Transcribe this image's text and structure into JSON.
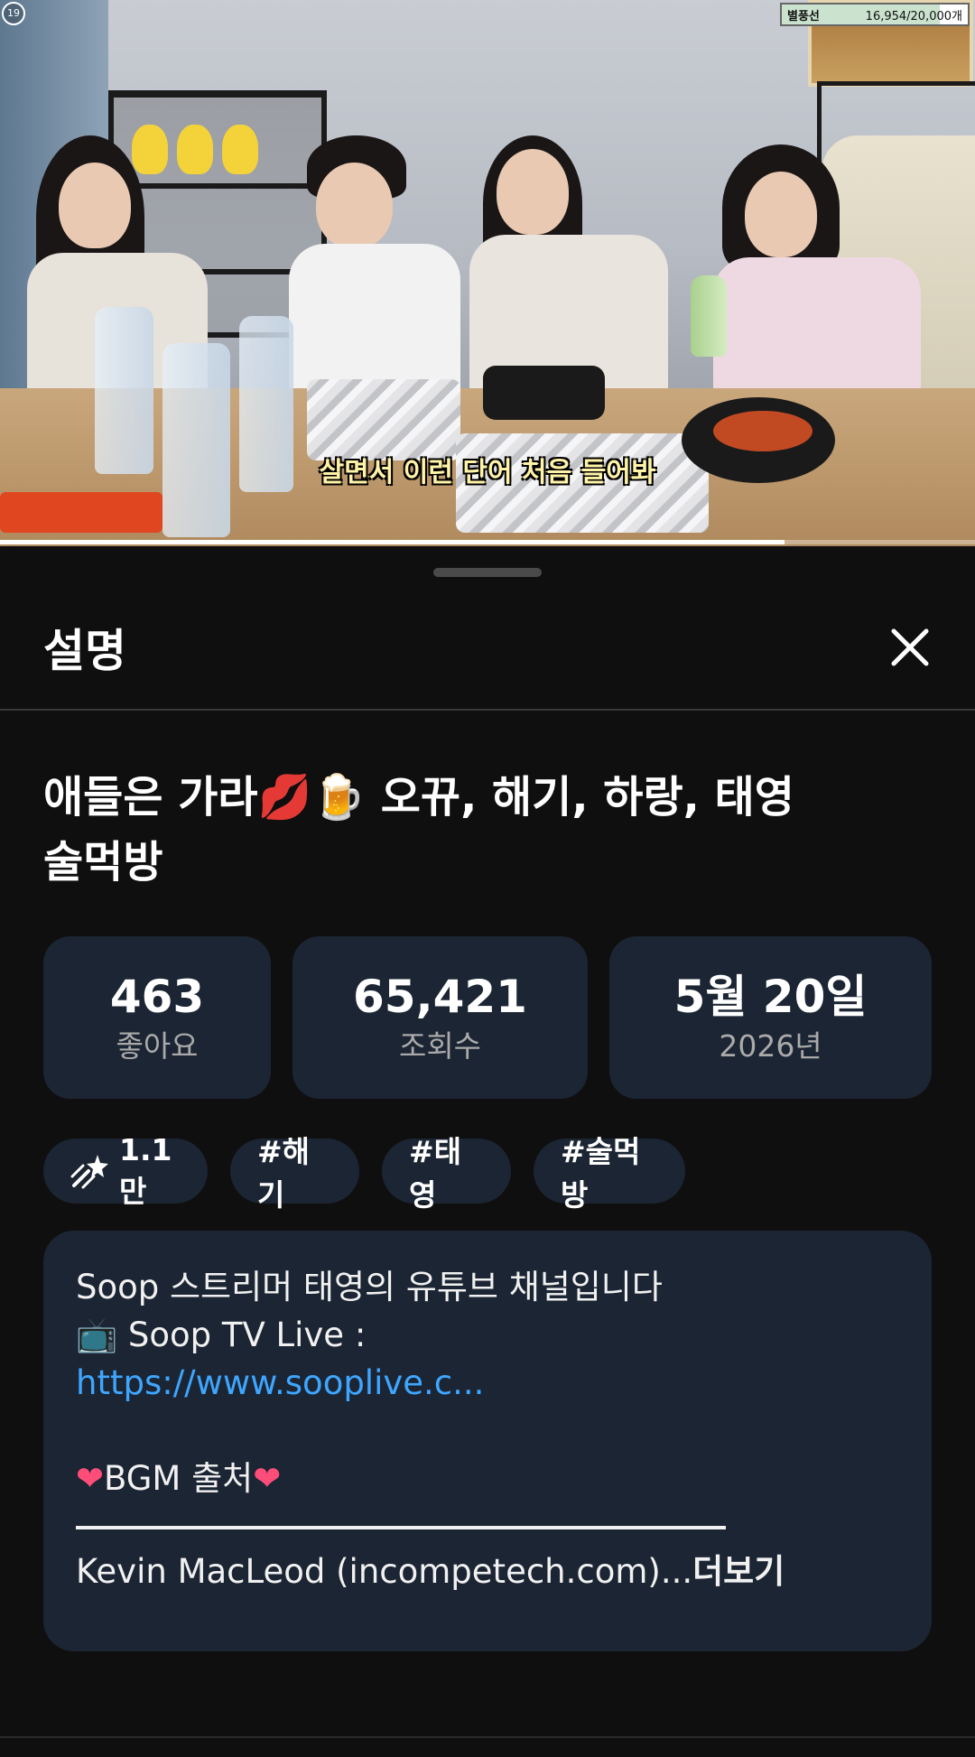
{
  "player": {
    "age_rating": "19",
    "balloon_label": "별풍선",
    "balloon_count": "16,954/20,000개",
    "balloon_progress": 0.85,
    "subtitle": "살면서 이런 단어 처음 들어봐",
    "progress_fraction": 0.805
  },
  "sheet": {
    "title": "설명",
    "close_icon": "close-icon"
  },
  "video": {
    "title_line1": "애들은 가라💋🍺 오뀨, 해기, 하랑, 태영",
    "title_line2": "술먹방"
  },
  "stats": [
    {
      "value": "463",
      "label": "좋아요"
    },
    {
      "value": "65,421",
      "label": "조회수"
    },
    {
      "value": "5월 20일",
      "label": "2026년"
    }
  ],
  "chips": [
    {
      "label": "1.1만",
      "icon": "shooting-star-icon"
    },
    {
      "label": "#해기"
    },
    {
      "label": "#태영"
    },
    {
      "label": "#술먹방"
    }
  ],
  "description": {
    "line1": "Soop 스트리머 태영의 유튜브 채널입니다",
    "line2": "📺 Soop TV Live :",
    "link": "https://www.sooplive.c...",
    "bgm_heading": "BGM 출처",
    "credit": "Kevin MacLeod (incompetech.com)...",
    "more": "더보기"
  },
  "colors": {
    "background": "#0f0f0f",
    "card": "#1c2533",
    "link": "#3ea6ff",
    "muted_text": "#aaaaaa"
  }
}
